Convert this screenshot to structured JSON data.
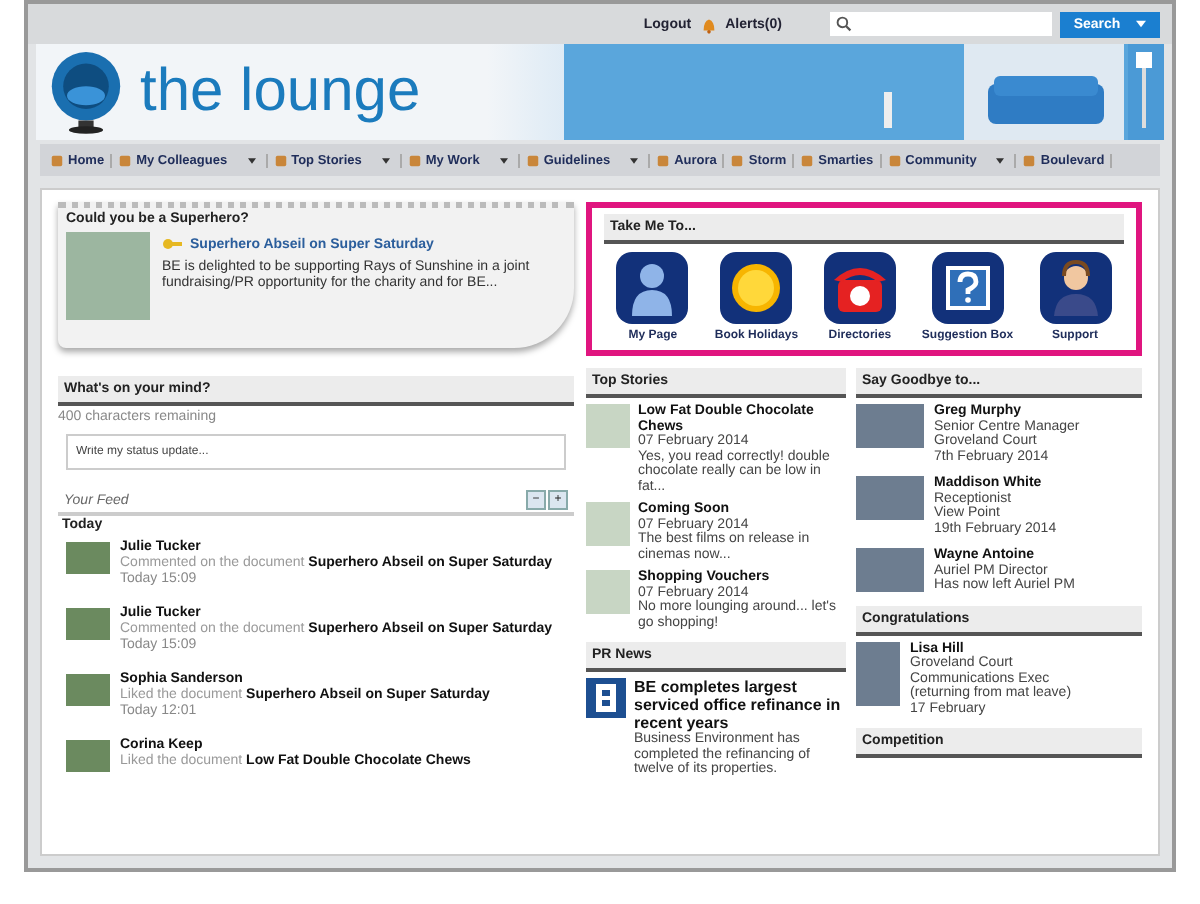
{
  "topbar": {
    "logout": "Logout",
    "alerts": "Alerts(0)",
    "search_button": "Search"
  },
  "banner": {
    "title": "the lounge"
  },
  "nav": [
    {
      "label": "Home",
      "has_menu": false
    },
    {
      "label": "My Colleagues",
      "has_menu": true
    },
    {
      "label": "Top Stories",
      "has_menu": true
    },
    {
      "label": "My Work",
      "has_menu": true
    },
    {
      "label": "Guidelines",
      "has_menu": true
    },
    {
      "label": "Aurora",
      "has_menu": false
    },
    {
      "label": "Storm",
      "has_menu": false
    },
    {
      "label": "Smarties",
      "has_menu": false
    },
    {
      "label": "Community",
      "has_menu": true
    },
    {
      "label": "Boulevard",
      "has_menu": false
    }
  ],
  "featured": {
    "heading": "Could you be a Superhero?",
    "link": "Superhero Abseil on Super Saturday",
    "text": "BE is delighted to be supporting Rays of Sunshine in a joint fundraising/PR opportunity for the charity and for BE..."
  },
  "status": {
    "heading": "What's on your mind?",
    "remaining": "400 characters remaining",
    "placeholder": "Write my status update..."
  },
  "feed": {
    "heading": "Your Feed",
    "collapse": "−",
    "expand": "+",
    "group": "Today",
    "items": [
      {
        "name": "Julie Tucker",
        "action": "Commented on the document **Superhero Abseil on Super Saturday**",
        "time": "Today 15:09"
      },
      {
        "name": "Julie Tucker",
        "action": "Commented on the document **Superhero Abseil on Super Saturday**",
        "time": "Today 15:09"
      },
      {
        "name": "Sophia Sanderson",
        "action": "Liked the document **Superhero Abseil on Super Saturday**",
        "time": "Today 12:01"
      },
      {
        "name": "Corina Keep",
        "action": "Liked the document **Low Fat Double Chocolate Chews**"
      }
    ]
  },
  "take_me_to": {
    "heading": "Take Me To...",
    "items": [
      {
        "label": "My Page",
        "kind": "person"
      },
      {
        "label": "Book Holidays",
        "kind": "sun"
      },
      {
        "label": "Directories",
        "kind": "phone"
      },
      {
        "label": "Suggestion Box",
        "kind": "question"
      },
      {
        "label": "Support",
        "kind": "headset"
      }
    ]
  },
  "top_stories": {
    "heading": "Top Stories",
    "items": [
      {
        "title": "Low Fat Double Chocolate Chews",
        "date": "07 February 2014",
        "text": "Yes, you read correctly! double chocolate really can be low in fat..."
      },
      {
        "title": "Coming Soon",
        "date": "07 February 2014",
        "text": "The best films on release in cinemas now..."
      },
      {
        "title": "Shopping Vouchers",
        "date": "07 February 2014",
        "text": "No more lounging around... let's go shopping!"
      }
    ]
  },
  "pr_news": {
    "heading": "PR News",
    "title": "BE completes largest serviced office refinance in recent years",
    "text": "Business Environment has completed the refinancing of twelve of its properties."
  },
  "goodbye": {
    "heading": "Say Goodbye to...",
    "people": [
      {
        "name": "Greg Murphy",
        "lines": [
          "Senior Centre Manager",
          "Groveland Court",
          "7th February 2014"
        ]
      },
      {
        "name": "Maddison White",
        "lines": [
          "Receptionist",
          "View Point",
          "19th February 2014"
        ]
      },
      {
        "name": "Wayne Antoine",
        "lines": [
          "Auriel PM Director",
          "Has now left Auriel PM"
        ]
      }
    ]
  },
  "congratulations": {
    "heading": "Congratulations",
    "name": "Lisa Hill",
    "lines": [
      "Groveland Court",
      "Communications Exec",
      "(returning from mat leave)",
      "17 February"
    ]
  },
  "competition": {
    "heading": "Competition"
  }
}
